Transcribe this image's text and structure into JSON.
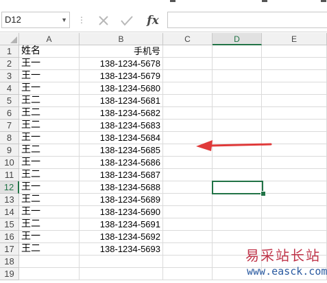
{
  "formula_bar": {
    "name_box": "D12",
    "cancel_icon": "cancel-icon",
    "enter_icon": "checkmark-icon",
    "fx_label": "fx",
    "formula_value": ""
  },
  "columns": [
    "A",
    "B",
    "C",
    "D",
    "E"
  ],
  "selected_column": "D",
  "rows": [
    {
      "num": "1",
      "a": "姓名",
      "b": "手机号"
    },
    {
      "num": "2",
      "a": "王一",
      "b": "138-1234-5678"
    },
    {
      "num": "3",
      "a": "王一",
      "b": "138-1234-5679"
    },
    {
      "num": "4",
      "a": "王一",
      "b": "138-1234-5680"
    },
    {
      "num": "5",
      "a": "王二",
      "b": "138-1234-5681"
    },
    {
      "num": "6",
      "a": "王二",
      "b": "138-1234-5682"
    },
    {
      "num": "7",
      "a": "王二",
      "b": "138-1234-5683"
    },
    {
      "num": "8",
      "a": "王一",
      "b": "138-1234-5684"
    },
    {
      "num": "9",
      "a": "王二",
      "b": "138-1234-5685"
    },
    {
      "num": "10",
      "a": "王一",
      "b": "138-1234-5686"
    },
    {
      "num": "11",
      "a": "王二",
      "b": "138-1234-5687"
    },
    {
      "num": "12",
      "a": "王一",
      "b": "138-1234-5688"
    },
    {
      "num": "13",
      "a": "王二",
      "b": "138-1234-5689"
    },
    {
      "num": "14",
      "a": "王一",
      "b": "138-1234-5690"
    },
    {
      "num": "15",
      "a": "王二",
      "b": "138-1234-5691"
    },
    {
      "num": "16",
      "a": "王一",
      "b": "138-1234-5692"
    },
    {
      "num": "17",
      "a": "王二",
      "b": "138-1234-5693"
    },
    {
      "num": "18",
      "a": "",
      "b": ""
    },
    {
      "num": "19",
      "a": "",
      "b": ""
    }
  ],
  "selected_row": "12",
  "annotation_arrow_color": "#e03a3a",
  "accent_color": "#217346",
  "watermark": {
    "text": "易采站长站",
    "url": "www.easck.com"
  }
}
